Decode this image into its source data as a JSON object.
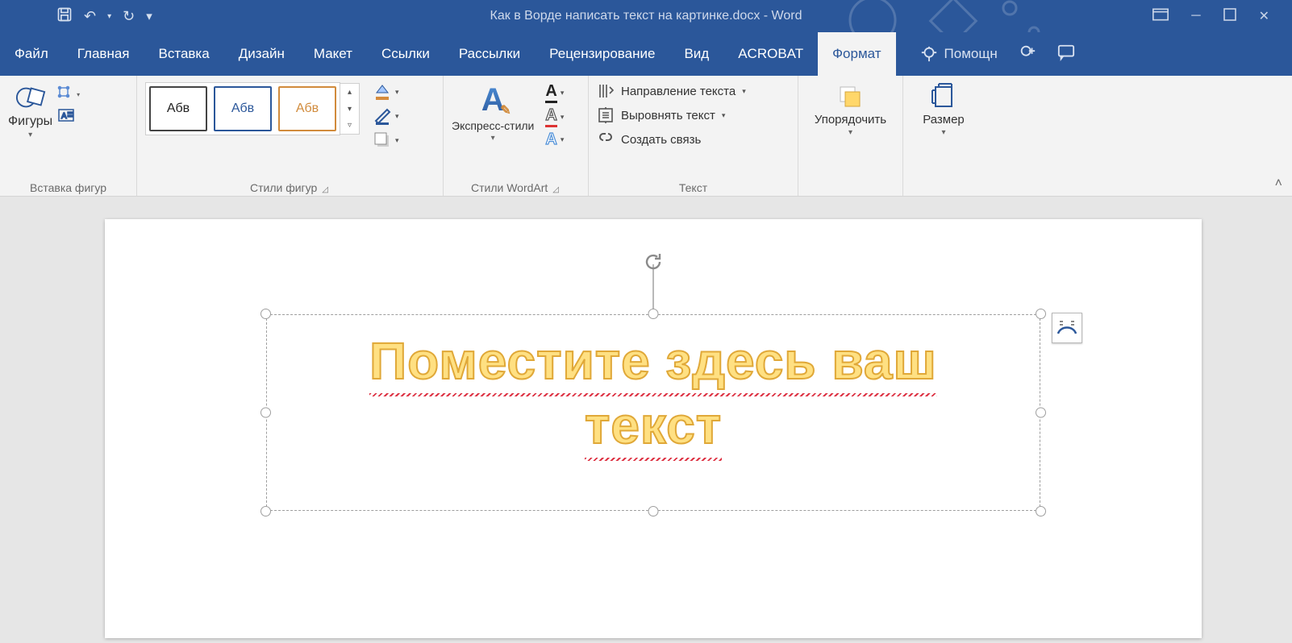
{
  "title": "Как в Ворде написать текст на картинке.docx - Word",
  "tabs": {
    "file": "Файл",
    "home": "Главная",
    "insert": "Вставка",
    "design": "Дизайн",
    "layout": "Макет",
    "references": "Ссылки",
    "mailings": "Рассылки",
    "review": "Рецензирование",
    "view": "Вид",
    "acrobat": "ACROBAT",
    "format": "Формат"
  },
  "help_hint": "Помощн",
  "ribbon": {
    "group1": {
      "label": "Вставка фигур",
      "shapes": "Фигуры"
    },
    "group2": {
      "label": "Стили фигур",
      "sample": "Абв"
    },
    "group3": {
      "label": "Стили WordArt",
      "express": "Экспресс-стили"
    },
    "group4": {
      "label": "Текст",
      "direction": "Направление текста",
      "align": "Выровнять текст",
      "link": "Создать связь"
    },
    "group5": {
      "label": "",
      "arrange": "Упорядочить"
    },
    "group6": {
      "label": "",
      "size": "Размер"
    }
  },
  "wordart": {
    "line1": "Поместите здесь ваш",
    "line2": "текст"
  }
}
